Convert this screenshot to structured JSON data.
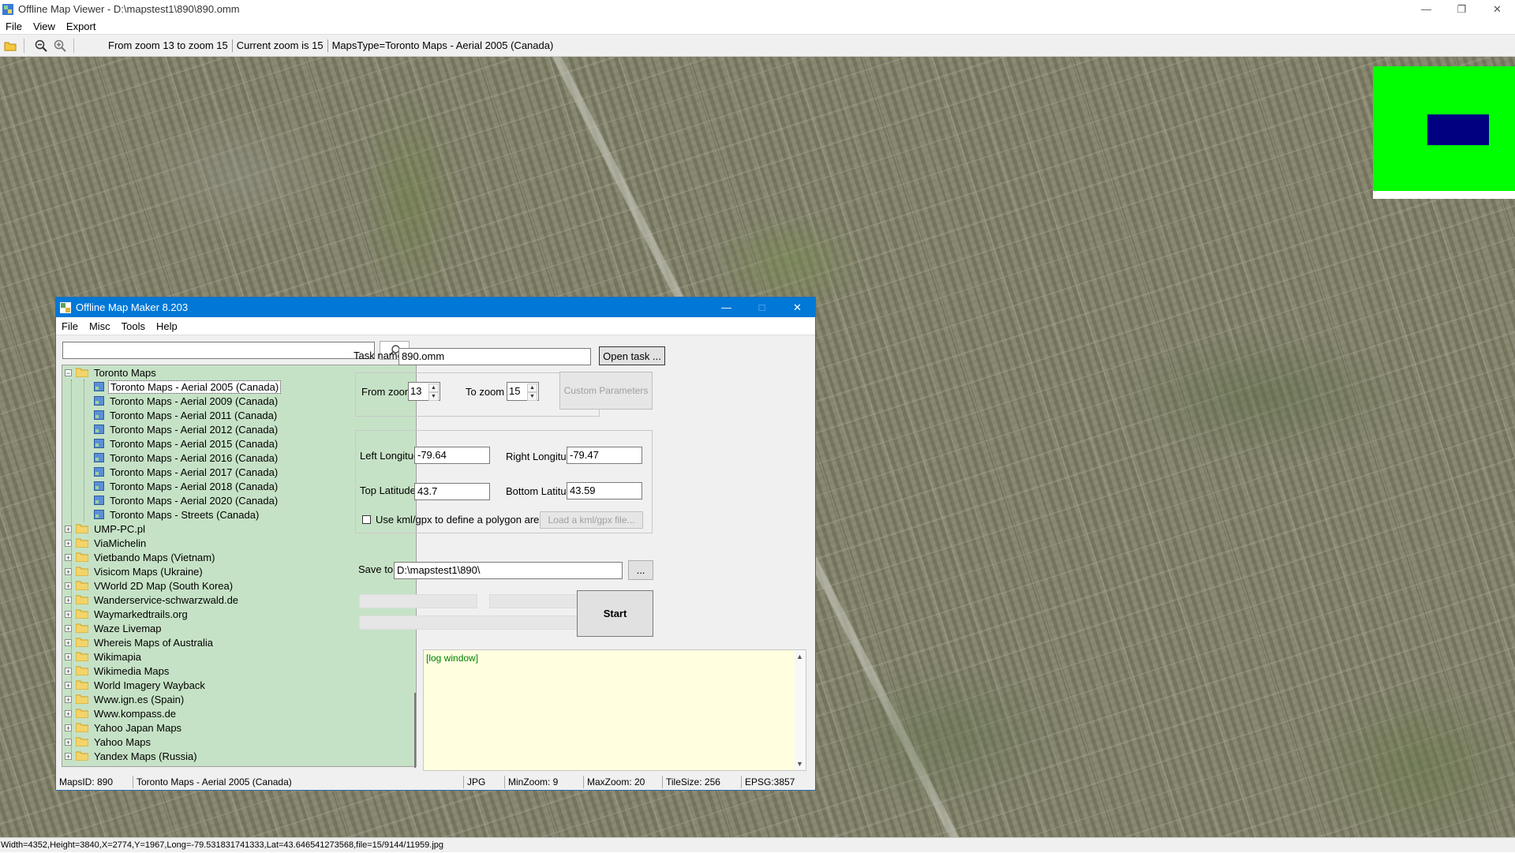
{
  "viewer": {
    "title": "Offline Map Viewer - D:\\mapstest1\\890\\890.omm",
    "menu": [
      "File",
      "View",
      "Export"
    ],
    "toolbar": {
      "icons": [
        "open-folder-icon",
        "zoom-out-icon",
        "zoom-in-icon"
      ],
      "zoom_range": "From zoom 13 to zoom 15",
      "current_zoom": "Current zoom is 15",
      "maps_type": "MapsType=Toronto Maps - Aerial 2005 (Canada)"
    },
    "status_line": "Width=4352,Height=3840,X=2774,Y=1967,Long=-79.531831741333,Lat=43.646541273568,file=15/9144/11959.jpg",
    "minimap_colors": {
      "background": "#00ff00",
      "viewport": "#000080"
    }
  },
  "maker": {
    "title": "Offline Map Maker 8.203",
    "menu": [
      "File",
      "Misc",
      "Tools",
      "Help"
    ],
    "search": {
      "value": ""
    },
    "tree": {
      "root": "Toronto Maps",
      "children": [
        "Toronto Maps - Aerial 2005 (Canada)",
        "Toronto Maps - Aerial 2009 (Canada)",
        "Toronto Maps - Aerial 2011 (Canada)",
        "Toronto Maps - Aerial 2012 (Canada)",
        "Toronto Maps - Aerial 2015 (Canada)",
        "Toronto Maps - Aerial 2016 (Canada)",
        "Toronto Maps - Aerial 2017 (Canada)",
        "Toronto Maps - Aerial 2018 (Canada)",
        "Toronto Maps - Aerial 2020 (Canada)",
        "Toronto Maps - Streets (Canada)"
      ],
      "selected": "Toronto Maps - Aerial 2005 (Canada)",
      "folders": [
        "UMP-PC.pl",
        "ViaMichelin",
        "Vietbando Maps (Vietnam)",
        "Visicom Maps (Ukraine)",
        "VWorld 2D Map (South Korea)",
        "Wanderservice-schwarzwald.de",
        "Waymarkedtrails.org",
        "Waze Livemap",
        "Whereis Maps of Australia",
        "Wikimapia",
        "Wikimedia Maps",
        "World Imagery Wayback",
        "Www.ign.es (Spain)",
        "Www.kompass.de",
        "Yahoo Japan Maps",
        "Yahoo Maps",
        "Yandex Maps (Russia)"
      ]
    },
    "task": {
      "label": "Task name",
      "value": "890.omm",
      "open_button": "Open task ..."
    },
    "zoom": {
      "from_label": "From zoom",
      "from_value": "13",
      "to_label": "To zoom",
      "to_value": "15",
      "custom_button": "Custom Parameters"
    },
    "bounds": {
      "left_lon_label": "Left Longitude",
      "left_lon": "-79.64",
      "right_lon_label": "Right Longitude",
      "right_lon": "-79.47",
      "top_lat_label": "Top Latitude",
      "top_lat": "43.7",
      "bottom_lat_label": "Bottom Latitude",
      "bottom_lat": "43.59",
      "kml_checkbox_label": "Use kml/gpx to define a polygon area",
      "kml_checked": false,
      "kml_button": "Load a kml/gpx file..."
    },
    "save": {
      "label": "Save to:",
      "value": "D:\\mapstest1\\890\\",
      "browse_button": "..."
    },
    "start_button": "Start",
    "progress": [
      0,
      0,
      0
    ],
    "log": "[log window]",
    "status": {
      "maps_id": "MapsID: 890",
      "maps_name": "Toronto Maps - Aerial 2005 (Canada)",
      "format": "JPG",
      "min_zoom": "MinZoom: 9",
      "max_zoom": "MaxZoom: 20",
      "tile_size": "TileSize: 256",
      "epsg": "EPSG:3857"
    }
  }
}
